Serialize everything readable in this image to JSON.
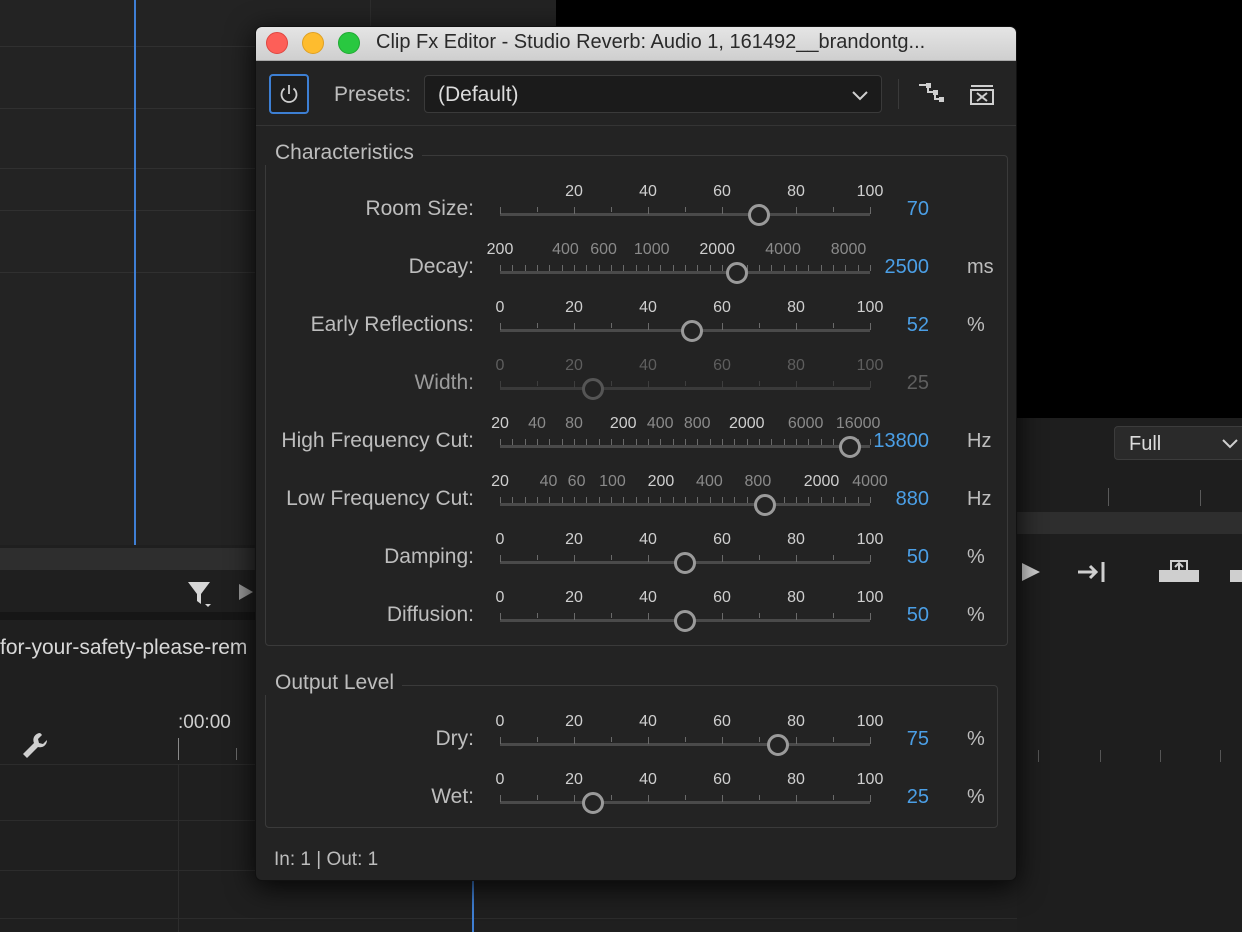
{
  "background": {
    "clip_name": "for-your-safety-please-rem",
    "timecode": ":00:00",
    "zoom_select": "Full"
  },
  "window": {
    "title": "Clip Fx Editor - Studio Reverb: Audio 1, 161492__brandontg...",
    "presets_label": "Presets:",
    "presets_value": "(Default)",
    "footer": "In: 1 | Out: 1"
  },
  "characteristics": {
    "title": "Characteristics",
    "rows": [
      {
        "label": "Room Size:",
        "value": "70",
        "unit": "",
        "level": 0.7,
        "scale": "lin100nz",
        "dim": false
      },
      {
        "label": "Decay:",
        "value": "2500",
        "unit": "ms",
        "level": 0.64,
        "scale": "decay",
        "dim": false
      },
      {
        "label": "Early Reflections:",
        "value": "52",
        "unit": "%",
        "level": 0.52,
        "scale": "lin100",
        "dim": false
      },
      {
        "label": "Width:",
        "value": "25",
        "unit": "",
        "level": 0.25,
        "scale": "lin100",
        "dim": true
      },
      {
        "label": "High Frequency Cut:",
        "value": "13800",
        "unit": "Hz",
        "level": 0.945,
        "scale": "hfc",
        "dim": false
      },
      {
        "label": "Low Frequency Cut:",
        "value": "880",
        "unit": "Hz",
        "level": 0.715,
        "scale": "lfc",
        "dim": false
      },
      {
        "label": "Damping:",
        "value": "50",
        "unit": "%",
        "level": 0.5,
        "scale": "lin100",
        "dim": false
      },
      {
        "label": "Diffusion:",
        "value": "50",
        "unit": "%",
        "level": 0.5,
        "scale": "lin100",
        "dim": false
      }
    ]
  },
  "output": {
    "title": "Output Level",
    "rows": [
      {
        "label": "Dry:",
        "value": "75",
        "unit": "%",
        "level": 0.75,
        "scale": "lin100",
        "dim": false
      },
      {
        "label": "Wet:",
        "value": "25",
        "unit": "%",
        "level": 0.25,
        "scale": "lin100",
        "dim": false
      }
    ]
  },
  "scales": {
    "lin100nz": [
      {
        "t": "20",
        "p": 0.2,
        "major": true
      },
      {
        "t": "40",
        "p": 0.4,
        "major": true
      },
      {
        "t": "60",
        "p": 0.6,
        "major": true
      },
      {
        "t": "80",
        "p": 0.8,
        "major": true
      },
      {
        "t": "100",
        "p": 1.0,
        "major": true
      }
    ],
    "lin100": [
      {
        "t": "0",
        "p": 0,
        "major": true
      },
      {
        "t": "20",
        "p": 0.2,
        "major": true
      },
      {
        "t": "40",
        "p": 0.4,
        "major": true
      },
      {
        "t": "60",
        "p": 0.6,
        "major": true
      },
      {
        "t": "80",
        "p": 0.8,
        "major": true
      },
      {
        "t": "100",
        "p": 1.0,
        "major": true
      }
    ],
    "decay": [
      {
        "t": "200",
        "p": 0,
        "major": true
      },
      {
        "t": "400",
        "p": 0.177,
        "major": false
      },
      {
        "t": "600",
        "p": 0.28,
        "major": false
      },
      {
        "t": "1000",
        "p": 0.41,
        "major": false
      },
      {
        "t": "2000",
        "p": 0.587,
        "major": true
      },
      {
        "t": "4000",
        "p": 0.765,
        "major": false
      },
      {
        "t": "8000",
        "p": 0.942,
        "major": false
      }
    ],
    "hfc": [
      {
        "t": "20",
        "p": 0,
        "major": true
      },
      {
        "t": "40",
        "p": 0.1,
        "major": false
      },
      {
        "t": "80",
        "p": 0.2,
        "major": false
      },
      {
        "t": "200",
        "p": 0.333,
        "major": true
      },
      {
        "t": "400",
        "p": 0.433,
        "major": false
      },
      {
        "t": "800",
        "p": 0.533,
        "major": false
      },
      {
        "t": "2000",
        "p": 0.667,
        "major": true
      },
      {
        "t": "6000",
        "p": 0.826,
        "major": false
      },
      {
        "t": "16000",
        "p": 0.968,
        "major": false
      }
    ],
    "lfc": [
      {
        "t": "20",
        "p": 0,
        "major": true
      },
      {
        "t": "40",
        "p": 0.131,
        "major": false
      },
      {
        "t": "60",
        "p": 0.207,
        "major": false
      },
      {
        "t": "100",
        "p": 0.304,
        "major": false
      },
      {
        "t": "200",
        "p": 0.435,
        "major": true
      },
      {
        "t": "400",
        "p": 0.566,
        "major": false
      },
      {
        "t": "800",
        "p": 0.697,
        "major": false
      },
      {
        "t": "2000",
        "p": 0.869,
        "major": true
      },
      {
        "t": "4000",
        "p": 1.0,
        "major": false
      }
    ]
  }
}
